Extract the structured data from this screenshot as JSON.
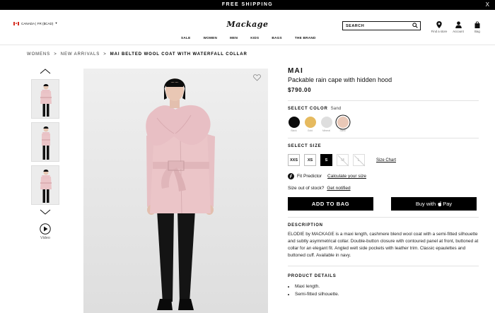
{
  "promo": {
    "text": "FREE SHIPPING",
    "close": "X"
  },
  "header": {
    "locale": "CANADA | FR ($CAD)",
    "logo": "Mackage",
    "nav": [
      "SALE",
      "WOMEN",
      "MEN",
      "KIDS",
      "BAGS",
      "THE BRAND"
    ],
    "search_placeholder": "SEARCH",
    "utils": {
      "store": "Find a store",
      "account": "Account",
      "bag": "Bag"
    }
  },
  "breadcrumb": {
    "path": "WOMENS  >  NEW ARRIVALS  >  ",
    "current": "MAI BELTED WOOL COAT WITH WATERFALL COLLAR"
  },
  "gallery": {
    "video_label": "Video"
  },
  "product": {
    "brand": "MAI",
    "subtitle": "Packable rain cape with hidden hood",
    "price": "$790.00",
    "color_label": "SELECT COLOR",
    "selected_color": "Sand",
    "colors": [
      {
        "name": "Black",
        "hex": "#0b0b0b"
      },
      {
        "name": "Gold",
        "hex": "#e6ba5f"
      },
      {
        "name": "Mineral",
        "hex": "#dedede"
      },
      {
        "name": "Sand",
        "hex": "#e9c8b7"
      }
    ],
    "size_label": "SELECT SIZE",
    "sizes": [
      "XXS",
      "XS",
      "S",
      "M",
      "L"
    ],
    "size_chart": "Size Chart",
    "fit_predictor": "Fit Predictor",
    "calculate_size": "Calculate your size",
    "out_of_stock": "Size out of stock?",
    "get_notified": "Get notified",
    "add_to_bag": "ADD TO BAG",
    "buy_with": "Buy with",
    "pay": "Pay",
    "description_title": "DESCRIPTION",
    "description": "ELODIE by MACKAGE is a maxi length, cashmere blend wool coat with a semi-fitted silhouette and subtly asymmetrical collar. Double-button closure with contoured panel at front, buttoned at collar for an elegant fit. Angled welt side pockets with leather trim. Classic epaulettes and buttoned cuff. Available in navy.",
    "details_title": "PRODUCT DETAILS",
    "details": [
      "Maxi length.",
      "Semi-fitted silhouette."
    ]
  }
}
